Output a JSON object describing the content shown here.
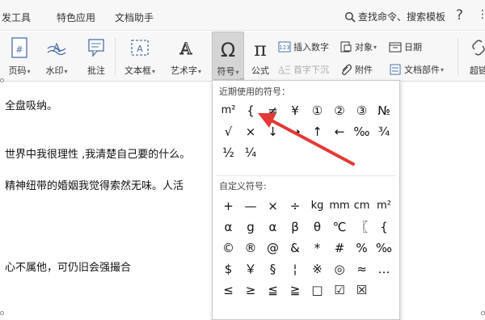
{
  "tabs": [
    {
      "label": "发工具"
    },
    {
      "label": "特色应用"
    },
    {
      "label": "文档助手"
    }
  ],
  "search": {
    "label": "查找命令、搜索模板"
  },
  "help": {
    "label": "?"
  },
  "ribbon": {
    "page_number": "页码",
    "watermark": "水印",
    "comment": "批注",
    "textbox": "文本框",
    "art_text": "艺术字",
    "symbol": "符号",
    "formula": "公式",
    "insert_number": "插入数字",
    "object": "对象",
    "date": "日期",
    "drop_cap": "首字下沉",
    "attachment": "附件",
    "doc_part": "文档部件",
    "hyperlink": "超链"
  },
  "document": {
    "lines": [
      "全盘吸纳。",
      "世界中我很理性 ,我清楚自己要的什么。",
      "精神纽带的婚姻我觉得索然无味。人活",
      "心不属他，可仍旧会强撮合"
    ]
  },
  "symbol_panel": {
    "recent_header": "近期使用的符号：",
    "custom_header": "自定义符号:",
    "recent": [
      "m²",
      "{",
      "≠",
      "¥",
      "①",
      "②",
      "③",
      "№",
      "√",
      "×",
      "↓",
      "→",
      "↑",
      "←",
      "‰",
      "¾",
      "½",
      "¼"
    ],
    "custom": [
      "+",
      "—",
      "×",
      "÷",
      "kg",
      "mm",
      "cm",
      "m²",
      "α",
      "g",
      "α",
      "β",
      "θ",
      "℃",
      "〖",
      "{",
      "©",
      "®",
      "@",
      "&",
      "*",
      "#",
      "%",
      "‰",
      "$",
      "￥",
      "§",
      "¦",
      "※",
      "◎",
      "≈",
      "…",
      "≤",
      "≥",
      "≦",
      "≧",
      "□",
      "☑",
      "☒"
    ]
  },
  "colors": {
    "accent_red": "#e53935",
    "ribbon_bg": "#f7f7f7",
    "symbol_button_bg": "#d5d5d5"
  }
}
